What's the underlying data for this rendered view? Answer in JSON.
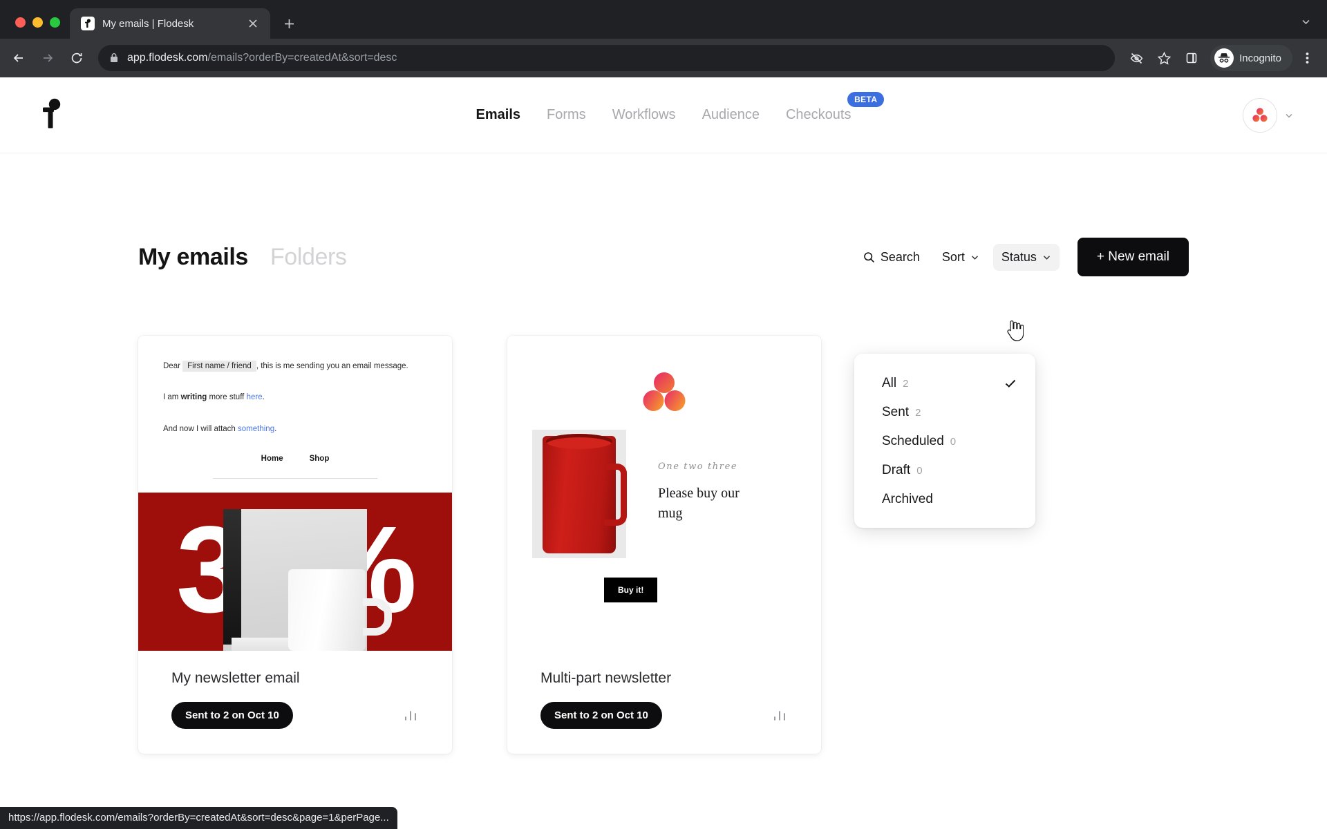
{
  "browser": {
    "tab": {
      "title": "My emails | Flodesk",
      "favicon_icon": "flodesk-f-icon",
      "close_icon": "close-icon"
    },
    "new_tab_icon": "plus-icon",
    "tab_list_icon": "chevron-down-icon",
    "nav": {
      "back_icon": "back-arrow-icon",
      "forward_icon": "forward-arrow-icon",
      "reload_icon": "reload-icon"
    },
    "omnibox": {
      "lock_icon": "lock-icon",
      "url_host": "app.flodesk.com",
      "url_path": "/emails?orderBy=createdAt&sort=desc"
    },
    "toolbar_right": {
      "tracking_icon": "eye-off-icon",
      "bookmark_icon": "star-icon",
      "side_panel_icon": "side-panel-icon",
      "incognito_label": "Incognito",
      "incognito_icon": "incognito-hat-icon",
      "menu_icon": "three-dot-menu-icon"
    },
    "status_bubble": "https://app.flodesk.com/emails?orderBy=createdAt&sort=desc&page=1&perPage..."
  },
  "app": {
    "logo_icon": "flodesk-logo-icon",
    "nav_items": [
      {
        "label": "Emails",
        "active": true
      },
      {
        "label": "Forms",
        "active": false
      },
      {
        "label": "Workflows",
        "active": false
      },
      {
        "label": "Audience",
        "active": false
      },
      {
        "label": "Checkouts",
        "active": false,
        "badge": "BETA"
      }
    ],
    "account": {
      "avatar_icon": "flodesk-dots-avatar",
      "chevron_icon": "chevron-down-icon"
    }
  },
  "header": {
    "title": "My emails",
    "secondary_tab": "Folders",
    "search_label": "Search",
    "search_icon": "search-icon",
    "sort_label": "Sort",
    "status_label": "Status",
    "chevron_icon": "chevron-down-icon",
    "new_email_label": "+ New email"
  },
  "status_dropdown": {
    "open": true,
    "check_icon": "check-icon",
    "items": [
      {
        "label": "All",
        "count": "2",
        "selected": true
      },
      {
        "label": "Sent",
        "count": "2",
        "selected": false
      },
      {
        "label": "Scheduled",
        "count": "0",
        "selected": false
      },
      {
        "label": "Draft",
        "count": "0",
        "selected": false
      },
      {
        "label": "Archived",
        "count": "",
        "selected": false
      }
    ]
  },
  "emails": [
    {
      "name": "My newsletter email",
      "status_pill": "Sent to 2 on Oct 10",
      "analytics_icon": "bar-chart-icon",
      "preview": {
        "line1_pre": "Dear",
        "line1_merge": "First name / friend",
        "line1_post": ", this is me sending you an email message.",
        "line2_pre": "I am ",
        "line2_bold": "writing",
        "line2_mid": " more stuff ",
        "line2_link": "here",
        "line2_post": ".",
        "line3_pre": "And now I will attach ",
        "line3_link": "something",
        "line3_post": ".",
        "nav": [
          "Home",
          "Shop"
        ],
        "banner_text": "30%",
        "banner_color": "#9e0f0b"
      }
    },
    {
      "name": "Multi-part newsletter",
      "status_pill": "Sent to 2 on Oct 10",
      "analytics_icon": "bar-chart-icon",
      "preview": {
        "logo_icon": "flodesk-dots-icon",
        "product_image": "red-mug-photo",
        "script_text": "One two three",
        "heading": "Please buy our mug",
        "cta_label": "Buy it!"
      }
    }
  ],
  "colors": {
    "accent_pink": "#e8276b",
    "accent_orange": "#f0802f",
    "beta_blue": "#3b6fe0",
    "banner_red": "#9e0f0b",
    "mug_red": "#bb1712",
    "link_blue": "#4a74ee",
    "black": "#0d0d0f"
  }
}
